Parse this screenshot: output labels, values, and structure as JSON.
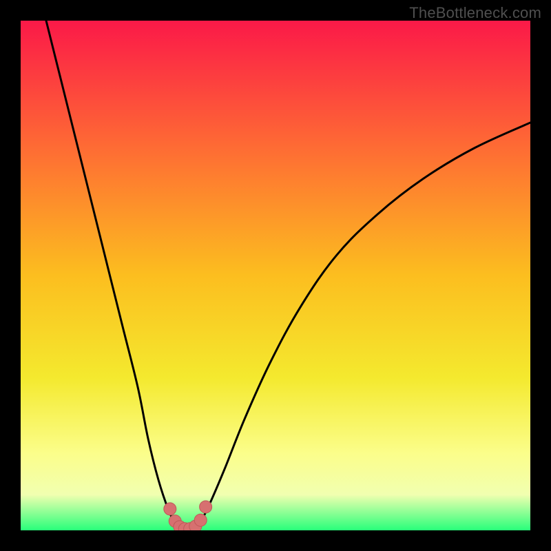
{
  "watermark": "TheBottleneck.com",
  "colors": {
    "gradient_top": "#fb1948",
    "gradient_mid1": "#fe6f33",
    "gradient_mid2": "#fcbe1f",
    "gradient_mid3": "#f4e92e",
    "gradient_mid4": "#fbfe8b",
    "gradient_bottom": "#28ff7a",
    "curve": "#000000",
    "marker_fill": "#d77070",
    "marker_stroke": "#bf5858",
    "frame_bg": "#000000"
  },
  "chart_data": {
    "type": "line",
    "title": "",
    "xlabel": "",
    "ylabel": "",
    "xlim": [
      0,
      100
    ],
    "ylim": [
      0,
      100
    ],
    "note": "Axes not shown; values are approximate readings of a bottleneck-percentage curve. Y is bottleneck % (0 at bottom, 100 at top). X is a relative component-balance axis.",
    "series": [
      {
        "name": "bottleneck_curve_left",
        "x": [
          5,
          8,
          11,
          14,
          17,
          20,
          23,
          25,
          27,
          29,
          30.5
        ],
        "y": [
          100,
          88,
          76,
          64,
          52,
          40,
          28,
          18,
          10,
          4,
          1
        ]
      },
      {
        "name": "bottleneck_curve_right",
        "x": [
          35,
          37,
          40,
          44,
          49,
          55,
          62,
          70,
          79,
          89,
          100
        ],
        "y": [
          1,
          5,
          12,
          22,
          33,
          44,
          54,
          62,
          69,
          75,
          80
        ]
      },
      {
        "name": "flat_zero_segment",
        "x": [
          30.5,
          31,
          32,
          33,
          34,
          35
        ],
        "y": [
          1,
          0.3,
          0,
          0,
          0.3,
          1
        ]
      }
    ],
    "markers": {
      "name": "sweet_spot_markers",
      "x": [
        29.3,
        30.3,
        31.2,
        32.2,
        33.2,
        34.3,
        35.3,
        36.3
      ],
      "y": [
        4.2,
        1.8,
        0.7,
        0.3,
        0.3,
        0.8,
        2.0,
        4.6
      ]
    }
  }
}
